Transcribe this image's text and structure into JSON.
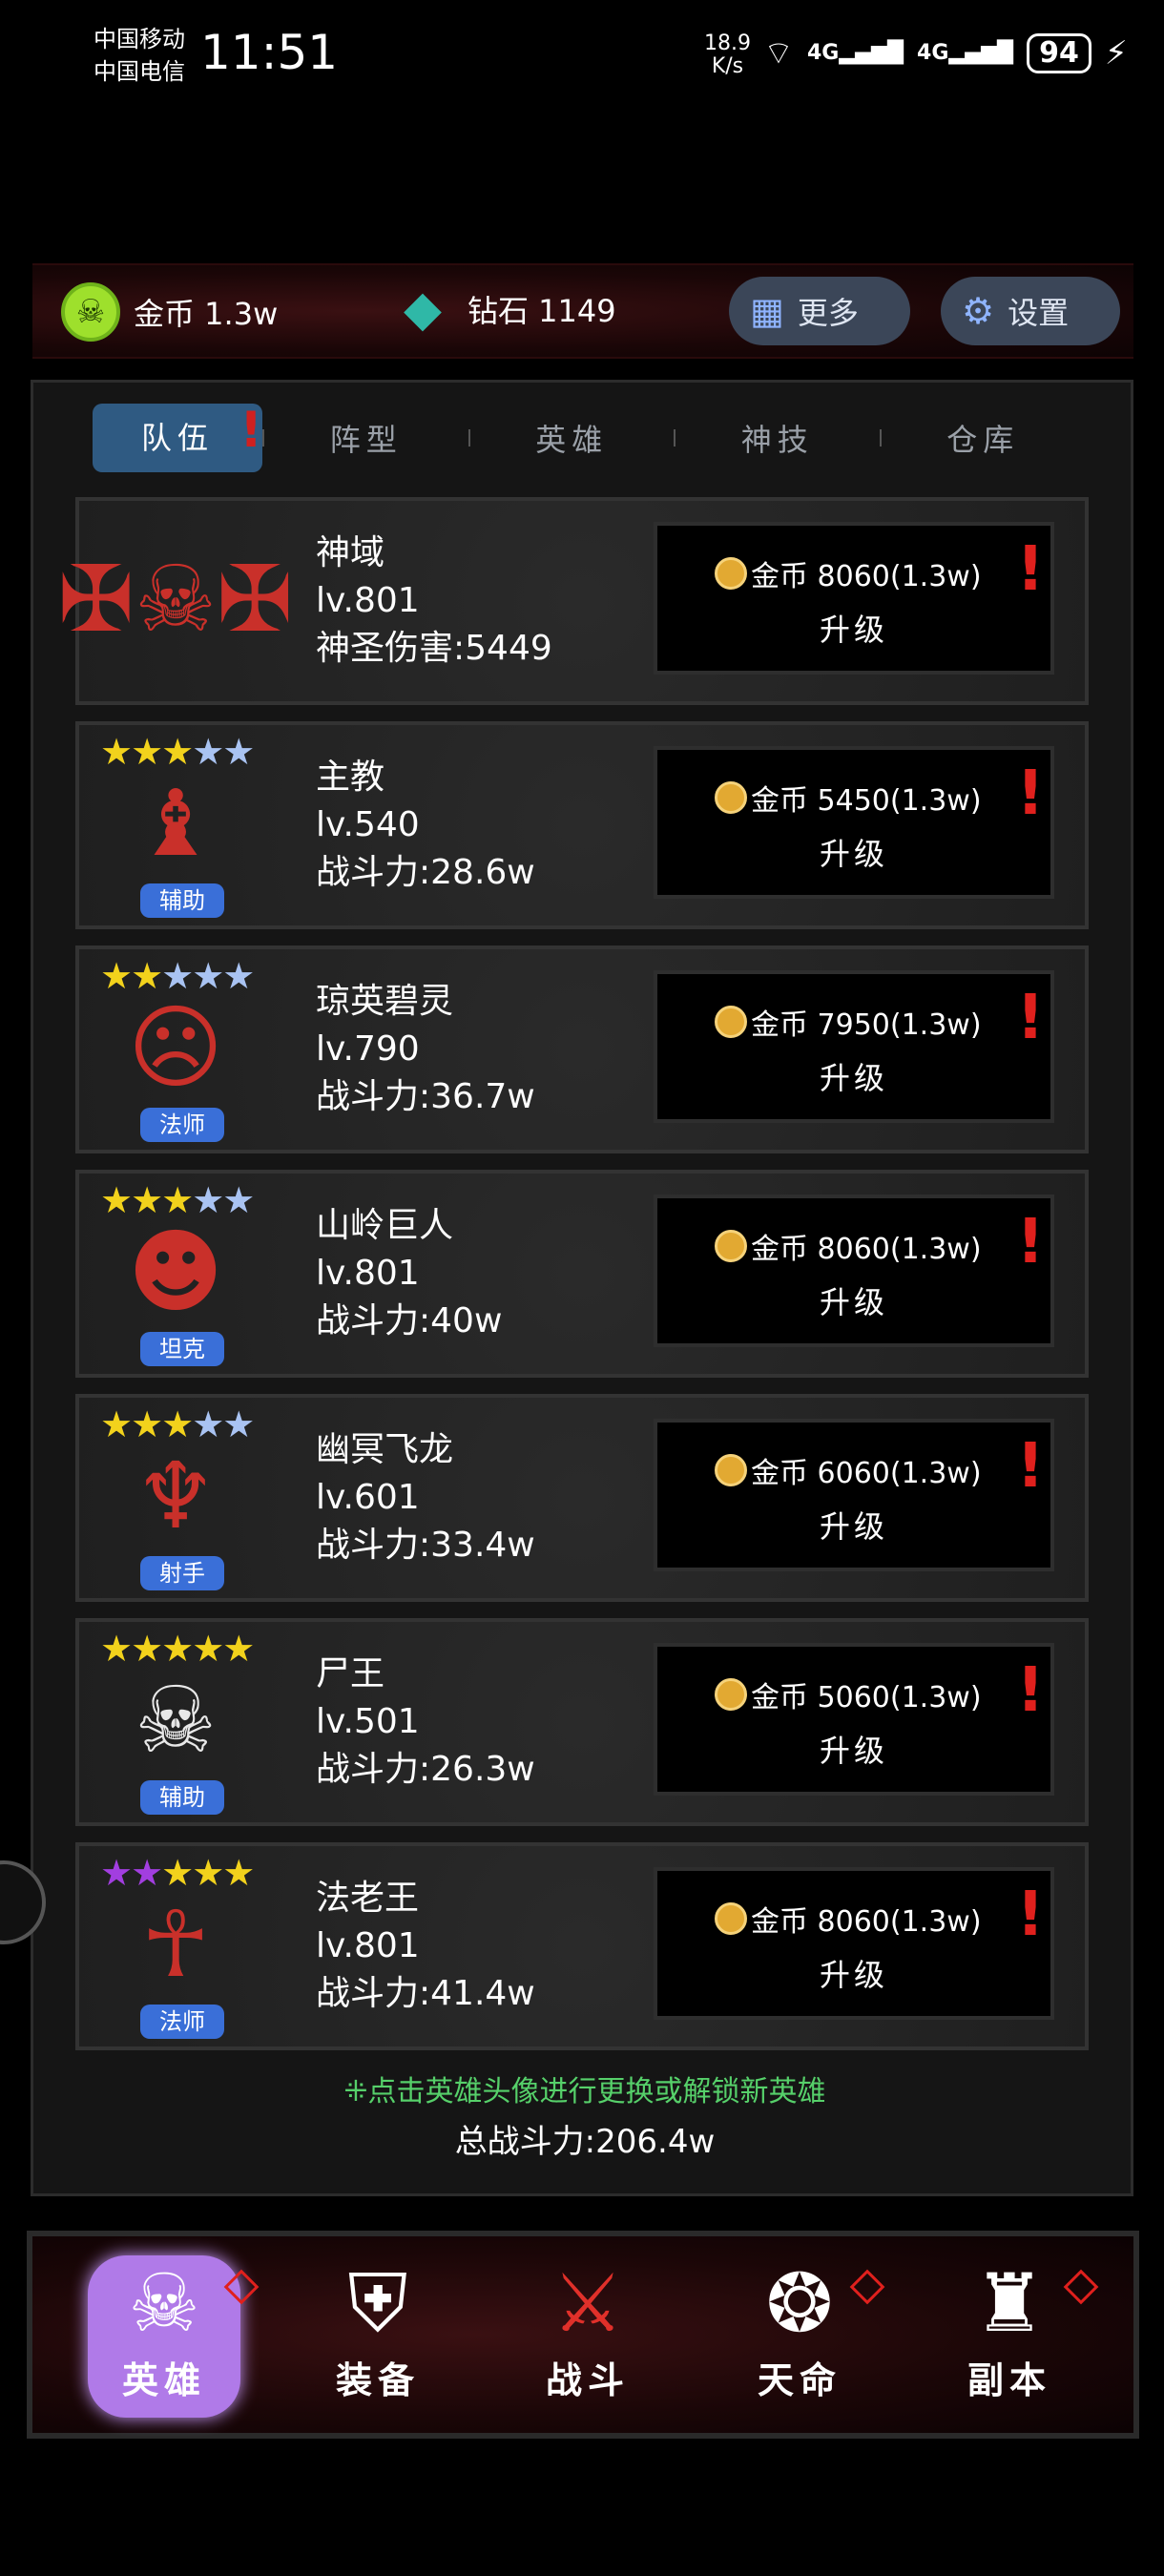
{
  "status_bar": {
    "carrier1": "中国移动",
    "carrier2": "中国电信",
    "time": "11:51",
    "net_speed_value": "18.9",
    "net_speed_unit": "K/s",
    "signal1": "4G",
    "signal2": "4G",
    "battery": "94"
  },
  "resources": {
    "gold_label": "金币 1.3w",
    "diamond_label": "钻石 1149",
    "more_label": "更多",
    "settings_label": "设置"
  },
  "tabs": [
    {
      "label": "队伍"
    },
    {
      "label": "阵型"
    },
    {
      "label": "英雄"
    },
    {
      "label": "神技"
    },
    {
      "label": "仓库"
    }
  ],
  "cards": [
    {
      "name": "神域",
      "level": "lv.801",
      "stat": "神圣伤害:5449",
      "cost": "金币 8060(1.3w)",
      "action": "升级",
      "role": "",
      "stars": ""
    },
    {
      "name": "主教",
      "level": "lv.540",
      "stat": "战斗力:28.6w",
      "cost": "金币 5450(1.3w)",
      "action": "升级",
      "role": "辅助",
      "stars": "★★★★★"
    },
    {
      "name": "琼英碧灵",
      "level": "lv.790",
      "stat": "战斗力:36.7w",
      "cost": "金币 7950(1.3w)",
      "action": "升级",
      "role": "法师",
      "stars": "★★★★★"
    },
    {
      "name": "山岭巨人",
      "level": "lv.801",
      "stat": "战斗力:40w",
      "cost": "金币 8060(1.3w)",
      "action": "升级",
      "role": "坦克",
      "stars": "★★★★★"
    },
    {
      "name": "幽冥飞龙",
      "level": "lv.601",
      "stat": "战斗力:33.4w",
      "cost": "金币 6060(1.3w)",
      "action": "升级",
      "role": "射手",
      "stars": "★★★★★"
    },
    {
      "name": "尸王",
      "level": "lv.501",
      "stat": "战斗力:26.3w",
      "cost": "金币 5060(1.3w)",
      "action": "升级",
      "role": "辅助",
      "stars": "★★★★★"
    },
    {
      "name": "法老王",
      "level": "lv.801",
      "stat": "战斗力:41.4w",
      "cost": "金币 8060(1.3w)",
      "action": "升级",
      "role": "法师",
      "stars": "★★★★★"
    }
  ],
  "hint": "⁜点击英雄头像进行更换或解锁新英雄",
  "total_power": "总战斗力:206.4w",
  "nav": [
    {
      "label": "英雄",
      "icon": "skull-icon"
    },
    {
      "label": "装备",
      "icon": "armor-icon"
    },
    {
      "label": "战斗",
      "icon": "crossed-swords-icon"
    },
    {
      "label": "天命",
      "icon": "fate-wheel-icon"
    },
    {
      "label": "副本",
      "icon": "castle-icon"
    }
  ],
  "colors": {
    "accent_tab": "#2f5a82",
    "alert": "#e0201d",
    "hint": "#56d06a",
    "role_badge": "#3a6fd8",
    "nav_active": "#b07ae8"
  }
}
